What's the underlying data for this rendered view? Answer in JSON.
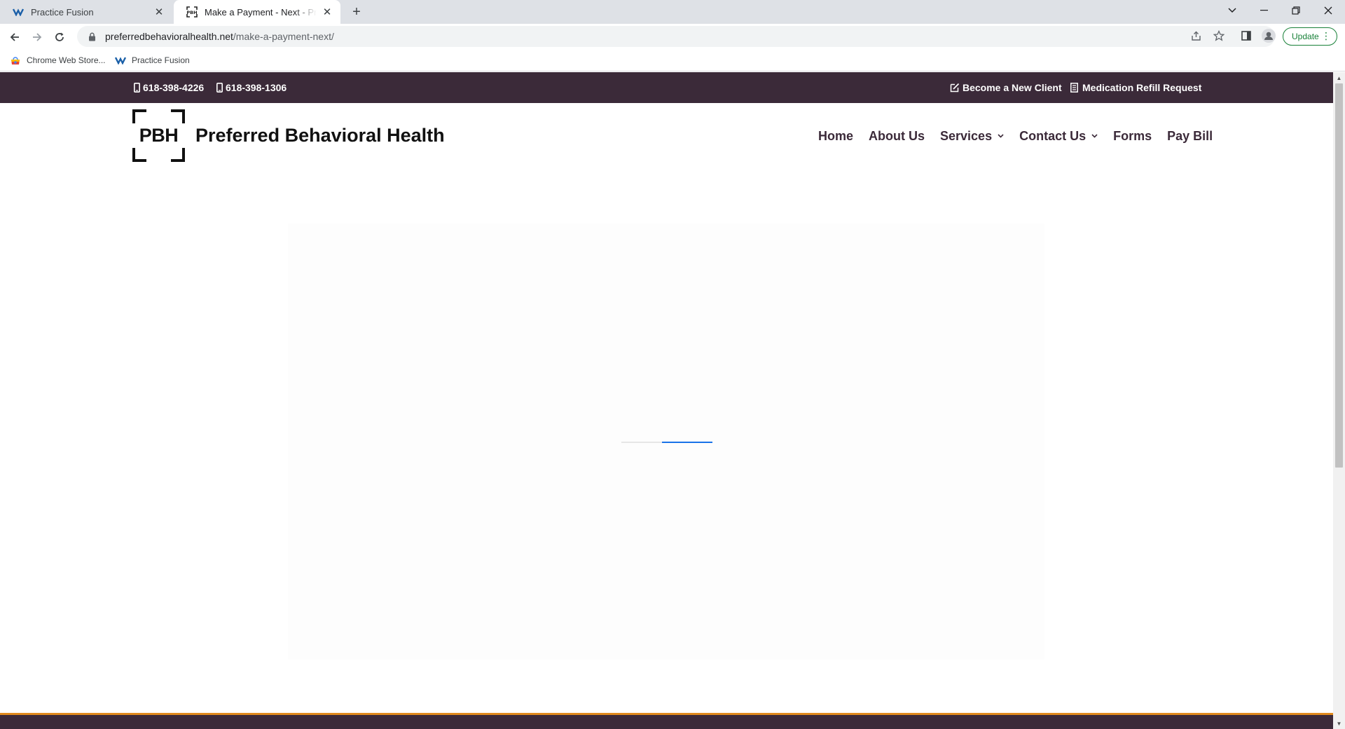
{
  "browser": {
    "tabs": [
      {
        "title": "Practice Fusion",
        "active": false
      },
      {
        "title": "Make a Payment - Next - Preferred Behavioral Health",
        "active": true
      }
    ],
    "url_host": "preferredbehavioralhealth.net",
    "url_path": "/make-a-payment-next/",
    "update_label": "Update",
    "bookmarks": [
      {
        "label": "Chrome Web Store..."
      },
      {
        "label": "Practice Fusion"
      }
    ]
  },
  "site": {
    "topbar": {
      "phone1": "618-398-4226",
      "phone2": "618-398-1306",
      "new_client": "Become a New Client",
      "refill": "Medication Refill Request"
    },
    "logo_mark": "PBH",
    "logo_name": "Preferred Behavioral Health",
    "nav": [
      {
        "label": "Home"
      },
      {
        "label": "About Us"
      },
      {
        "label": "Services"
      },
      {
        "label": "Contact Us"
      },
      {
        "label": "Forms"
      },
      {
        "label": "Pay Bill"
      }
    ]
  },
  "colors": {
    "brand_dark": "#3b2a39",
    "accent": "#e08a1e",
    "loader": "#1a73e8"
  }
}
